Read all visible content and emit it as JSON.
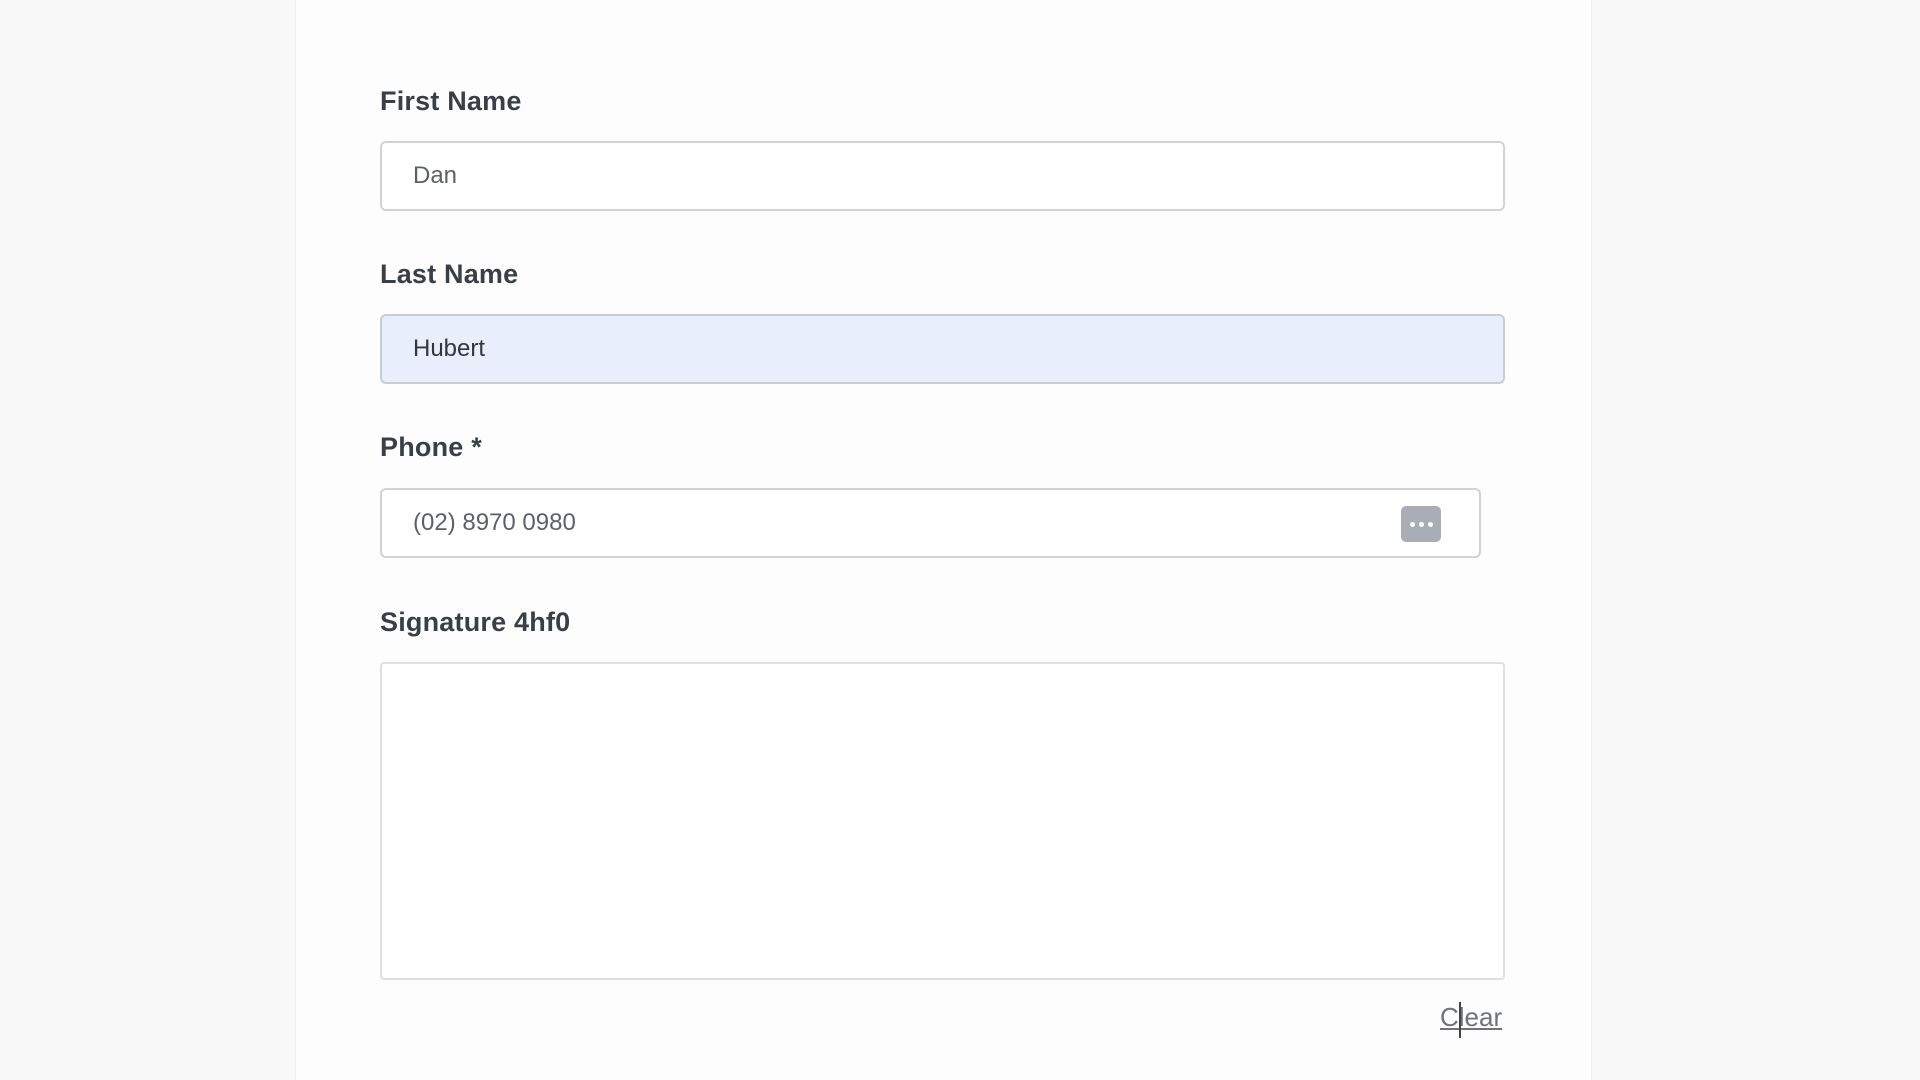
{
  "form": {
    "first_name": {
      "label": "First Name",
      "value": "Dan"
    },
    "last_name": {
      "label": "Last Name",
      "value": "Hubert"
    },
    "phone": {
      "label": "Phone *",
      "value": "(02) 8970 0980",
      "action_icon": "more-dots-icon"
    },
    "signature": {
      "label": "Signature 4hf0",
      "clear_label": "Clear"
    }
  },
  "colors": {
    "autofill_background": "#e8eefa",
    "label_text": "#3a3f47",
    "border": "#cfd2d6"
  }
}
